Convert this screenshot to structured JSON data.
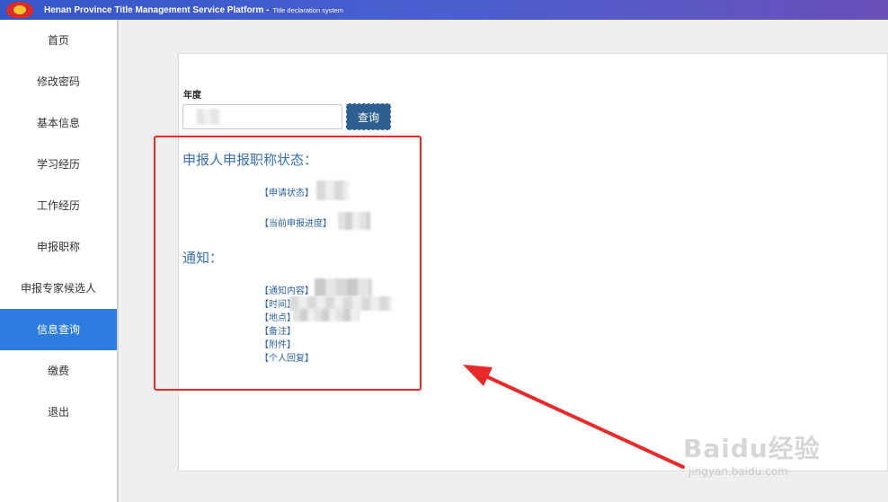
{
  "header": {
    "title": "Henan Province Title Management Service Platform -",
    "subtitle": "Title declaration system"
  },
  "sidebar": {
    "items": [
      {
        "label": "首页",
        "active": false
      },
      {
        "label": "修改密码",
        "active": false
      },
      {
        "label": "基本信息",
        "active": false
      },
      {
        "label": "学习经历",
        "active": false
      },
      {
        "label": "工作经历",
        "active": false
      },
      {
        "label": "申报职称",
        "active": false
      },
      {
        "label": "申报专家候选人",
        "active": false
      },
      {
        "label": "信息查询",
        "active": true
      },
      {
        "label": "缴费",
        "active": false
      },
      {
        "label": "退出",
        "active": false
      }
    ]
  },
  "search": {
    "year_label": "年度",
    "button_label": "查询"
  },
  "status": {
    "title": "申报人申报职称状态：",
    "apply_status_label": "【申请状态】",
    "progress_label": "【当前申报进度】"
  },
  "notice": {
    "title": "通知：",
    "content_label": "【通知内容】",
    "time_label": "【时间】",
    "place_label": "【地点】",
    "remark_label": "【备注】",
    "attachment_label": "【附件】",
    "reply_label": "【个人回复】"
  },
  "watermark": {
    "logo": "Baidu经验",
    "url": "jingyan.baidu.com"
  },
  "colors": {
    "header_start": "#3457c9",
    "header_end": "#6a4fb8",
    "sidebar_active": "#2d7ce0",
    "button": "#2d5f91",
    "link_text": "#2f62a4",
    "highlight": "#e92a2a"
  }
}
